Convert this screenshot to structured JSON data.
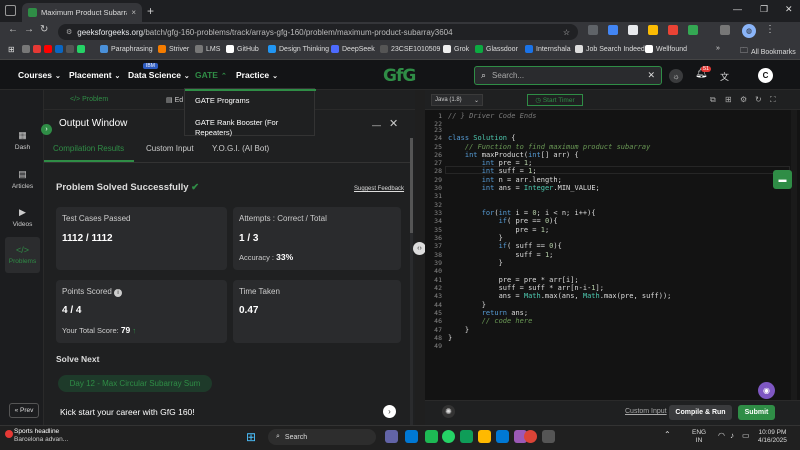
{
  "browser": {
    "tab_title": "Maximum Product Subarray | P",
    "url_host": "geeksforgeeks.org",
    "url_path": "/batch/gfg-160-problems/track/arrays-gfg-160/problem/maximum-product-subarray3604",
    "bookmarks": [
      "Paraphrasing",
      "Striver",
      "LMS",
      "GitHub",
      "Design Thinking",
      "DeepSeek",
      "23CSE1010509",
      "Grok",
      "Glassdoor",
      "Internshala",
      "Job Search Indeed",
      "Wellfound"
    ],
    "all_bookmarks": "All Bookmarks"
  },
  "site_nav": {
    "menu": [
      "Courses",
      "Placement",
      "Data Science",
      "GATE",
      "Practice"
    ],
    "ibm_badge": "IBM",
    "logo": "GfG",
    "search_placeholder": "Search...",
    "notif_count": "51",
    "avatar": "C"
  },
  "gate_dropdown": [
    "GATE Programs",
    "GATE Rank Booster (For",
    "Repeaters)"
  ],
  "rail": [
    "Dash",
    "Articles",
    "Videos",
    "Problems"
  ],
  "rail_prev": "Prev",
  "problem_tabs": [
    "Problem",
    "Ed"
  ],
  "output": {
    "title": "Output Window",
    "tabs": [
      "Compilation Results",
      "Custom Input",
      "Y.O.G.I. (AI Bot)"
    ],
    "status": "Problem Solved Successfully",
    "feedback": "Suggest Feedback",
    "test_cases_label": "Test Cases Passed",
    "test_cases_value": "1112 / 1112",
    "attempts_label": "Attempts : Correct / Total",
    "attempts_value": "1 / 3",
    "accuracy_label": "Accuracy :",
    "accuracy_value": "33%",
    "points_label": "Points Scored",
    "points_value": "4 / 4",
    "total_score_label": "Your Total Score:",
    "total_score_value": "79",
    "time_label": "Time Taken",
    "time_value": "0.47",
    "solve_next": "Solve Next",
    "next_problem": "Day 12 - Max Circular Subarray Sum",
    "kickstart": "Kick start your career with GfG 160!"
  },
  "editor": {
    "language": "Java (1.8)",
    "start_timer": "Start Timer",
    "line_numbers": [
      "1",
      "22",
      "23",
      "24",
      "25",
      "26",
      "27",
      "28",
      "29",
      "30",
      "31",
      "32",
      "33",
      "34",
      "35",
      "36",
      "37",
      "38",
      "39",
      "40",
      "41",
      "42",
      "43",
      "44",
      "45",
      "46",
      "47",
      "48",
      "49"
    ],
    "custom_input": "Custom Input",
    "compile_run": "Compile & Run",
    "submit": "Submit"
  },
  "taskbar": {
    "news_title": "Sports headline",
    "news_sub": "Barcelona advan...",
    "search": "Search",
    "lang": "ENG",
    "region": "IN",
    "time": "10:09 PM",
    "date": "4/16/2025"
  }
}
